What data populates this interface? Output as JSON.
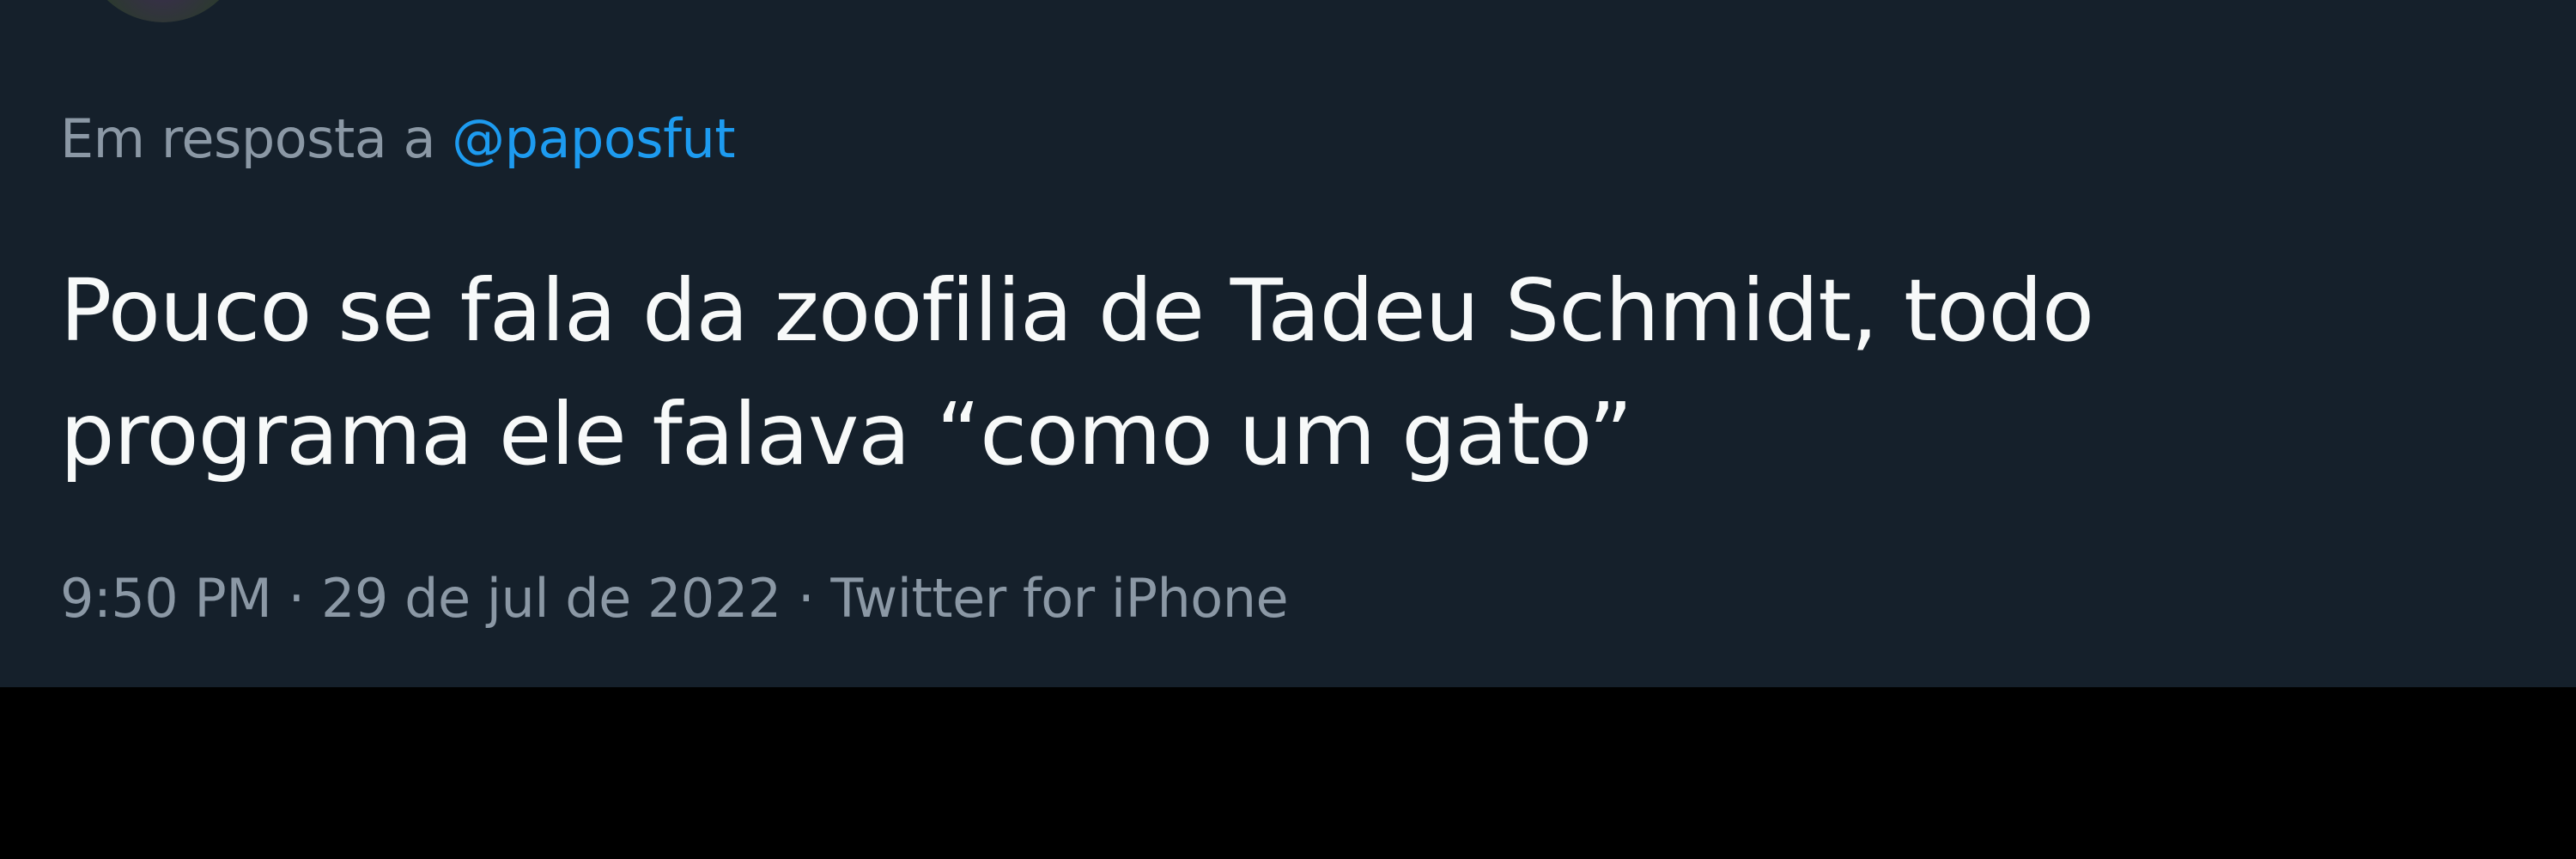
{
  "tweet": {
    "reply_prefix": "Em resposta a",
    "reply_handle": "@paposfut",
    "text_line_1": "Pouco se fala da zoofilia de Tadeu Schmidt, todo",
    "text_line_2": "programa ele falava “como um gato”",
    "time": "9:50 PM",
    "separator": "·",
    "date": "29 de jul de 2022",
    "source": "Twitter for iPhone"
  },
  "colors": {
    "background": "#15202b",
    "outer_background": "#000000",
    "text_primary": "#f7f9f9",
    "text_secondary": "#8b98a5",
    "link": "#1d9bf0"
  }
}
